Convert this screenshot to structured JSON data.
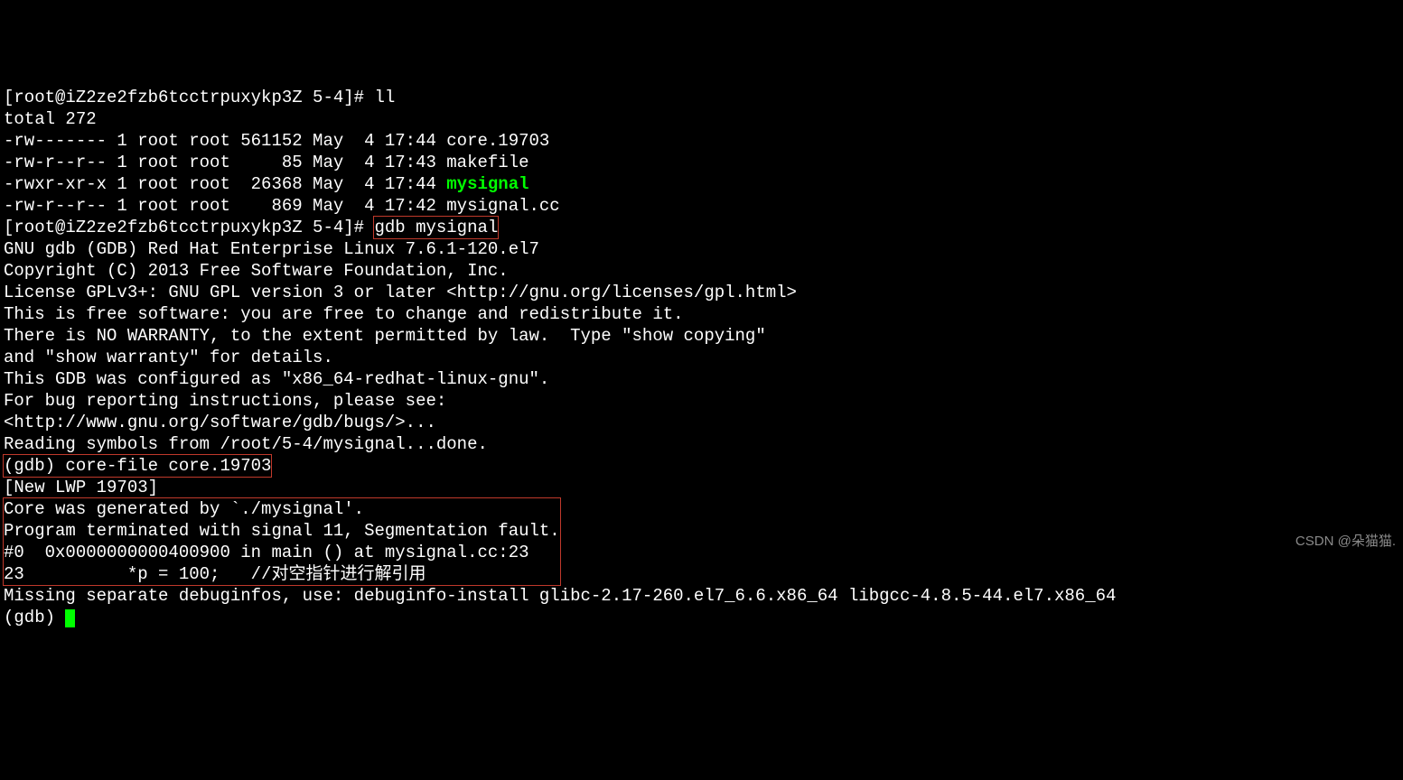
{
  "prompt1": "[root@iZ2ze2fzb6tcctrpuxykp3Z 5-4]# ",
  "cmd_ll": "ll",
  "ls": {
    "total": "total 272",
    "rows": [
      "-rw------- 1 root root 561152 May  4 17:44 core.19703",
      "-rw-r--r-- 1 root root     85 May  4 17:43 makefile",
      "-rwxr-xr-x 1 root root  26368 May  4 17:44 ",
      "-rw-r--r-- 1 root root    869 May  4 17:42 mysignal.cc"
    ],
    "exec_name": "mysignal"
  },
  "prompt2": "[root@iZ2ze2fzb6tcctrpuxykp3Z 5-4]# ",
  "cmd_gdb": "gdb mysignal",
  "gdb_intro": [
    "GNU gdb (GDB) Red Hat Enterprise Linux 7.6.1-120.el7",
    "Copyright (C) 2013 Free Software Foundation, Inc.",
    "License GPLv3+: GNU GPL version 3 or later <http://gnu.org/licenses/gpl.html>",
    "This is free software: you are free to change and redistribute it.",
    "There is NO WARRANTY, to the extent permitted by law.  Type \"show copying\"",
    "and \"show warranty\" for details.",
    "This GDB was configured as \"x86_64-redhat-linux-gnu\".",
    "For bug reporting instructions, please see:",
    "<http://www.gnu.org/software/gdb/bugs/>...",
    "Reading symbols from /root/5-4/mysignal...done."
  ],
  "gdb_cmd1": "(gdb) core-file core.19703",
  "lwp": "[New LWP 19703]",
  "crash_box": [
    "Core was generated by `./mysignal'.",
    "Program terminated with signal 11, Segmentation fault.",
    "#0  0x0000000000400900 in main () at mysignal.cc:23",
    "23          *p = 100;   //对空指针进行解引用"
  ],
  "missing": "Missing separate debuginfos, use: debuginfo-install glibc-2.17-260.el7_6.6.x86_64 libgcc-4.8.5-44.el7.x86_64",
  "gdb_prompt": "(gdb) ",
  "watermark": "CSDN @朵猫猫."
}
